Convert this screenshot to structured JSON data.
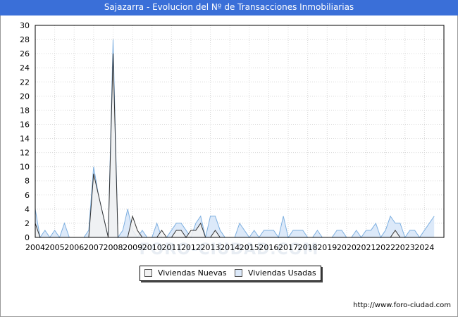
{
  "title": "Sajazarra - Evolucion del Nº de Transacciones Inmobiliarias",
  "watermark": "FORO-CIUDAD.COM",
  "source": "http://www.foro-ciudad.com",
  "colors": {
    "title_bar": "#3a6fd8",
    "nuevas_fill": "#f2f2f2",
    "nuevas_line": "#333333",
    "usadas_fill": "#dce9f9",
    "usadas_line": "#7fb0e0",
    "grid": "#d8d8d8"
  },
  "chart_data": {
    "type": "area",
    "title": "Sajazarra - Evolucion del Nº de Transacciones Inmobiliarias",
    "xlabel": "",
    "ylabel": "",
    "xlim": [
      2004,
      2025
    ],
    "ylim": [
      0,
      30
    ],
    "y_ticks": [
      0,
      2,
      4,
      6,
      8,
      10,
      12,
      14,
      16,
      18,
      20,
      22,
      24,
      26,
      28,
      30
    ],
    "x_ticks": [
      "2004",
      "2005",
      "2006",
      "2007",
      "2008",
      "2009",
      "2010",
      "2011",
      "2012",
      "2013",
      "2014",
      "2015",
      "2016",
      "2017",
      "2018",
      "2019",
      "2020",
      "2021",
      "2022",
      "2023",
      "2024"
    ],
    "grid": true,
    "legend_position": "bottom",
    "x_step": 0.25,
    "series": [
      {
        "name": "Viviendas Nuevas",
        "values": [
          2,
          0,
          0,
          0,
          0,
          0,
          0,
          0,
          0,
          0,
          0,
          0,
          9,
          6,
          3,
          0,
          26,
          0,
          0,
          0,
          3,
          1,
          0,
          0,
          0,
          0,
          1,
          0,
          0,
          1,
          1,
          0,
          1,
          1,
          2,
          0,
          0,
          1,
          0,
          0,
          0,
          0,
          0,
          0,
          0,
          0,
          0,
          0,
          0,
          0,
          0,
          0,
          0,
          0,
          0,
          0,
          0,
          0,
          0,
          0,
          0,
          0,
          0,
          0,
          0,
          0,
          0,
          0,
          0,
          0,
          0,
          0,
          0,
          0,
          1,
          0,
          0,
          0,
          0,
          0,
          0,
          0,
          0,
          0,
          0
        ]
      },
      {
        "name": "Viviendas Usadas",
        "values": [
          4,
          0,
          1,
          0,
          1,
          0,
          2,
          0,
          0,
          0,
          0,
          1,
          10,
          6,
          3,
          0,
          28,
          0,
          1,
          4,
          1,
          0,
          1,
          0,
          0,
          2,
          0,
          0,
          1,
          2,
          2,
          1,
          0,
          2,
          3,
          0,
          3,
          3,
          1,
          0,
          0,
          0,
          2,
          1,
          0,
          1,
          0,
          1,
          1,
          1,
          0,
          3,
          0,
          1,
          1,
          1,
          0,
          0,
          1,
          0,
          0,
          0,
          1,
          1,
          0,
          0,
          1,
          0,
          1,
          1,
          2,
          0,
          1,
          3,
          2,
          2,
          0,
          1,
          1,
          0,
          1,
          2,
          3
        ]
      }
    ]
  }
}
